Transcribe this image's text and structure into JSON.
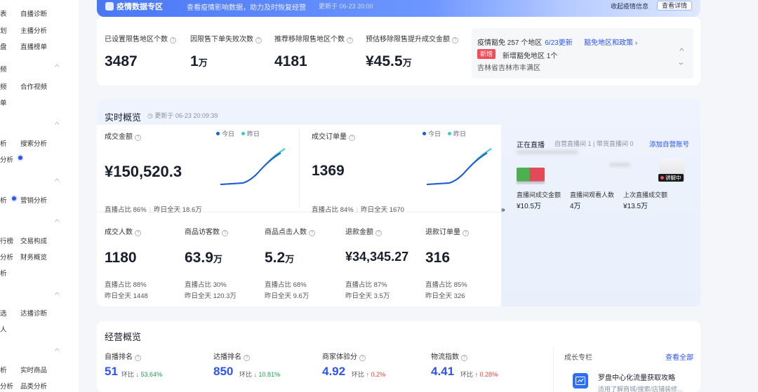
{
  "sidebar": {
    "items": [
      "表",
      "自播诊断",
      "划",
      "主播分析",
      "盘",
      "直播榜单",
      "频",
      "频",
      "合作视频",
      "单",
      "析",
      "搜索分析",
      "分析",
      "析",
      "营销分析",
      "行榜",
      "交易构成",
      "分析",
      "财务概览",
      "析",
      "选",
      "达播诊断",
      "人",
      "析",
      "实时商品",
      "分析",
      "品类分析"
    ]
  },
  "banner": {
    "title": "疫情数据专区",
    "subtitle": "查看疫情影响数据，助力及时恢复经营",
    "time": "更新于 06-23 20:00",
    "fold_label": "收起疫情信息",
    "detail_button": "查看详情"
  },
  "stats": [
    {
      "label": "已设置限售地区个数",
      "value": "3487",
      "unit": ""
    },
    {
      "label": "因限售下单失败次数",
      "value": "1",
      "unit": "万"
    },
    {
      "label": "推荐移除限售地区个数",
      "value": "4181",
      "unit": ""
    },
    {
      "label": "预估移除限售提升成交金额",
      "value": "¥45.5",
      "unit": "万"
    }
  ],
  "notice": {
    "summary": "疫情豁免 257 个地区",
    "updated": "6/23更新",
    "link": "豁免地区和政策",
    "new_badge": "新增",
    "new_text": "新增豁免地区 1个",
    "region": "吉林省吉林市丰满区"
  },
  "realtime": {
    "title": "实时概览",
    "time": "更新于 06-23 20:09:39",
    "legend": {
      "today": "今日",
      "yesterday": "昨日"
    },
    "main_metrics": [
      {
        "label": "成交金额",
        "value": "¥150,520.3",
        "unit": "",
        "ratio": "直播占比 86%",
        "yesterday": "昨日全天 18.6万"
      },
      {
        "label": "成交订单量",
        "value": "1369",
        "unit": "",
        "ratio": "直播占比 84%",
        "yesterday": "昨日全天 1670"
      }
    ],
    "metrics": [
      {
        "label": "成交人数",
        "value": "1180",
        "unit": "",
        "ratio": "直播占比 88%",
        "yesterday": "昨日全天 1448"
      },
      {
        "label": "商品访客数",
        "value": "63.9",
        "unit": "万",
        "ratio": "直播占比 30%",
        "yesterday": "昨日全天 120.3万"
      },
      {
        "label": "商品点击人数",
        "value": "5.2",
        "unit": "万",
        "ratio": "直播占比 68%",
        "yesterday": "昨日全天 9.6万"
      },
      {
        "label": "退款金额",
        "value": "¥34,345.27",
        "unit": "",
        "ratio": "直播占比 87%",
        "yesterday": "昨日全天 3.5万"
      },
      {
        "label": "退款订单量",
        "value": "316",
        "unit": "",
        "ratio": "直播占比 85%",
        "yesterday": "昨日全天 326"
      }
    ],
    "expand_icon": "»",
    "live": {
      "title": "正在直播",
      "status": "自营直播间 1 | 带货直播间 0",
      "add_link": "添加自营账号",
      "badge": "讲解中",
      "stats": [
        {
          "label": "直播间成交金额",
          "value": "¥10.5万"
        },
        {
          "label": "直播间观看人数",
          "value": "4万"
        },
        {
          "label": "上次直播成交额",
          "value": "¥13.5万"
        }
      ]
    }
  },
  "business": {
    "title": "经营概览",
    "compare_label": "环比",
    "items": [
      {
        "label": "自播排名",
        "value": "51",
        "trend": "down",
        "change": "53.64%"
      },
      {
        "label": "达播排名",
        "value": "850",
        "trend": "down",
        "change": "10.81%"
      },
      {
        "label": "商家体验分",
        "value": "4.92",
        "trend": "up",
        "change": "0.2%"
      },
      {
        "label": "物流指数",
        "value": "4.41",
        "trend": "up",
        "change": "0.28%"
      }
    ],
    "column": {
      "title": "成长专栏",
      "all_link": "查看全部",
      "article_title": "罗盘中心化流量获取攻略",
      "article_desc": "适用了解商城/搜索/店铺装修..."
    }
  },
  "colors": {
    "accent": "#2f54eb",
    "today_line": "#1d5bd6",
    "yesterday_line": "#3ecbc3",
    "up": "#e8453c",
    "down": "#1aa34a"
  }
}
